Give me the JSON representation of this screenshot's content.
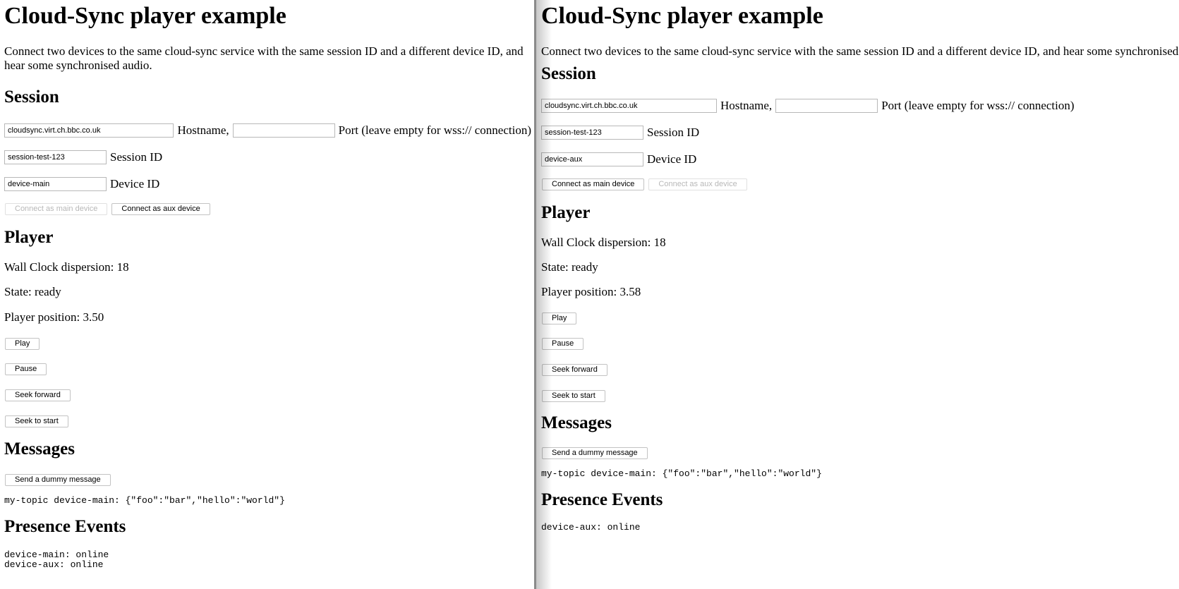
{
  "left": {
    "title": "Cloud-Sync player example",
    "intro": "Connect two devices to the same cloud-sync service with the same session ID and a different device ID, and hear some synchronised audio.",
    "session_heading": "Session",
    "hostname_value": "cloudsync.virt.ch.bbc.co.uk",
    "hostname_label": "Hostname,",
    "port_value": "",
    "port_label": "Port (leave empty for wss:// connection)",
    "session_id_value": "session-test-123",
    "session_id_label": "Session ID",
    "device_id_value": "device-main",
    "device_id_label": "Device ID",
    "connect_main_label": "Connect as main device",
    "connect_aux_label": "Connect as aux device",
    "player_heading": "Player",
    "wallclock": "Wall Clock dispersion: 18",
    "state": "State: ready",
    "position": "Player position: 3.50",
    "play_label": "Play",
    "pause_label": "Pause",
    "seek_forward_label": "Seek forward",
    "seek_start_label": "Seek to start",
    "messages_heading": "Messages",
    "send_dummy_label": "Send a dummy message",
    "message_line": "my-topic device-main: {\"foo\":\"bar\",\"hello\":\"world\"}",
    "presence_heading": "Presence Events",
    "presence_lines": [
      "device-main: online",
      "device-aux: online"
    ]
  },
  "right": {
    "title": "Cloud-Sync player example",
    "intro": "Connect two devices to the same cloud-sync service with the same session ID and a different device ID, and hear some synchronised audio.",
    "session_heading": "Session",
    "hostname_value": "cloudsync.virt.ch.bbc.co.uk",
    "hostname_label": "Hostname,",
    "port_value": "",
    "port_label": "Port (leave empty for wss:// connection)",
    "session_id_value": "session-test-123",
    "session_id_label": "Session ID",
    "device_id_value": "device-aux",
    "device_id_label": "Device ID",
    "connect_main_label": "Connect as main device",
    "connect_aux_label": "Connect as aux device",
    "player_heading": "Player",
    "wallclock": "Wall Clock dispersion: 18",
    "state": "State: ready",
    "position": "Player position: 3.58",
    "play_label": "Play",
    "pause_label": "Pause",
    "seek_forward_label": "Seek forward",
    "seek_start_label": "Seek to start",
    "messages_heading": "Messages",
    "send_dummy_label": "Send a dummy message",
    "message_line": "my-topic device-main: {\"foo\":\"bar\",\"hello\":\"world\"}",
    "presence_heading": "Presence Events",
    "presence_lines": [
      "device-aux: online"
    ]
  }
}
